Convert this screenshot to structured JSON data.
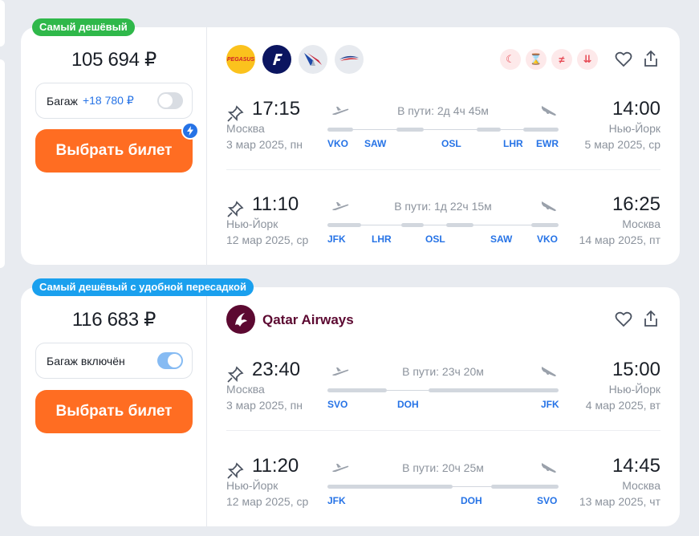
{
  "cards": [
    {
      "badge": "Самый дешёвый",
      "price": "105 694 ₽",
      "baggage": {
        "label": "Багаж",
        "extra": "+18 780 ₽",
        "included": false
      },
      "buy_label": "Выбрать билет",
      "fast_icon": "lightning-icon",
      "airlines": [
        {
          "name": "Pegasus",
          "logo_text": "PEGASUS",
          "color": "#fbc21d"
        },
        {
          "name": "Finnair",
          "logo_text": "F",
          "color": "#0b1560"
        },
        {
          "name": "American Airlines",
          "logo_text": "",
          "color": "#e7eaef"
        },
        {
          "name": "British Airways",
          "logo_text": "",
          "color": "#e7eaef"
        }
      ],
      "features": [
        {
          "icon": "night-icon",
          "glyph": "☾"
        },
        {
          "icon": "hourglass-icon",
          "glyph": "⌛"
        },
        {
          "icon": "not-equal-icon",
          "glyph": "≠"
        },
        {
          "icon": "bag-icon",
          "glyph": "⇊"
        }
      ],
      "segments": [
        {
          "dep_time": "17:15",
          "dep_city": "Москва",
          "dep_date": "3 мар 2025, пн",
          "arr_time": "14:00",
          "arr_city": "Нью-Йорк",
          "arr_date": "5 мар 2025, ср",
          "duration": "В пути: 2д 4ч 45м",
          "codes": [
            "VKO",
            "SAW",
            "OSL",
            "LHR",
            "EWR"
          ]
        },
        {
          "dep_time": "11:10",
          "dep_city": "Нью-Йорк",
          "dep_date": "12 мар 2025, ср",
          "arr_time": "16:25",
          "arr_city": "Москва",
          "arr_date": "14 мар 2025, пт",
          "duration": "В пути: 1д 22ч 15м",
          "codes": [
            "JFK",
            "LHR",
            "OSL",
            "SAW",
            "VKO"
          ]
        }
      ]
    },
    {
      "badge": "Самый дешёвый с удобной пересадкой",
      "price": "116 683 ₽",
      "baggage": {
        "label": "Багаж включён",
        "extra": "",
        "included": true
      },
      "buy_label": "Выбрать билет",
      "airline_name": "Qatar Airways",
      "segments": [
        {
          "dep_time": "23:40",
          "dep_city": "Москва",
          "dep_date": "3 мар 2025, пн",
          "arr_time": "15:00",
          "arr_city": "Нью-Йорк",
          "arr_date": "4 мар 2025, вт",
          "duration": "В пути: 23ч 20м",
          "codes": [
            "SVO",
            "DOH",
            "JFK"
          ]
        },
        {
          "dep_time": "11:20",
          "dep_city": "Нью-Йорк",
          "dep_date": "12 мар 2025, ср",
          "arr_time": "14:45",
          "arr_city": "Москва",
          "arr_date": "13 мар 2025, чт",
          "duration": "В пути: 20ч 25м",
          "codes": [
            "JFK",
            "DOH",
            "SVO"
          ]
        }
      ]
    }
  ],
  "colors": {
    "accent": "#ff6d22",
    "link": "#2673e6",
    "badge_green": "#2fb84a",
    "badge_blue": "#1aa0ee"
  }
}
